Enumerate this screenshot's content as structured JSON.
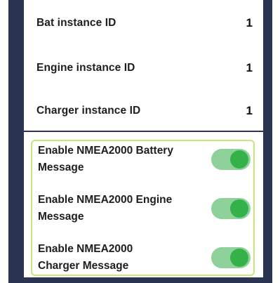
{
  "instances": [
    {
      "label": "Bat instance ID",
      "value": "1"
    },
    {
      "label": "Engine instance ID",
      "value": "1"
    },
    {
      "label": "Charger instance ID",
      "value": "1"
    }
  ],
  "nmea_options": [
    {
      "label_line1": "Enable NMEA2000 Battery",
      "label_line2": "Message",
      "enabled": true
    },
    {
      "label_line1": "Enable NMEA2000 Engine",
      "label_line2": "Message",
      "enabled": true
    },
    {
      "label_line1": "Enable NMEA2000",
      "label_line2": "Charger Message",
      "enabled": true
    }
  ],
  "colors": {
    "frame": "#2b3552",
    "highlight_border": "#c6e879",
    "toggle_track": "#8fd19a",
    "toggle_knob": "#35b14a"
  }
}
